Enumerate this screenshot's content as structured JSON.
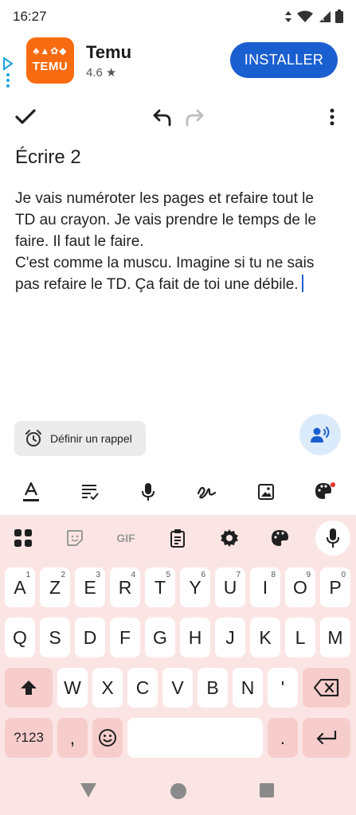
{
  "status_bar": {
    "time": "16:27"
  },
  "ad": {
    "app_name": "Temu",
    "rating": "4.6 ★",
    "logo_text": "TEMU",
    "install_label": "INSTALLER"
  },
  "note": {
    "title": "Écrire 2",
    "body": "Je vais numéroter les pages et refaire tout le TD au crayon. Je vais prendre le temps de le faire. Il faut le faire.\nC'est comme la muscu. Imagine si tu ne sais pas refaire le TD. Ça fait de toi une débile."
  },
  "reminder": {
    "label": "Définir un rappel"
  },
  "keyboard": {
    "toolbar": {
      "gif_label": "GIF"
    },
    "row1": [
      {
        "key": "A",
        "hint": "1"
      },
      {
        "key": "Z",
        "hint": "2"
      },
      {
        "key": "E",
        "hint": "3"
      },
      {
        "key": "R",
        "hint": "4"
      },
      {
        "key": "T",
        "hint": "5"
      },
      {
        "key": "Y",
        "hint": "6"
      },
      {
        "key": "U",
        "hint": "7"
      },
      {
        "key": "I",
        "hint": "8"
      },
      {
        "key": "O",
        "hint": "9"
      },
      {
        "key": "P",
        "hint": "0"
      }
    ],
    "row2": [
      "Q",
      "S",
      "D",
      "F",
      "G",
      "H",
      "J",
      "K",
      "L",
      "M"
    ],
    "row3": [
      "W",
      "X",
      "C",
      "V",
      "B",
      "N",
      "'"
    ],
    "row4": {
      "symbols": "?123",
      "comma": ",",
      "period": "."
    }
  },
  "colors": {
    "accent": "#1a5fd0",
    "keyboard_bg": "#fbe5e4",
    "alt_key": "#f6cdcb",
    "temu_orange": "#f96b10"
  }
}
